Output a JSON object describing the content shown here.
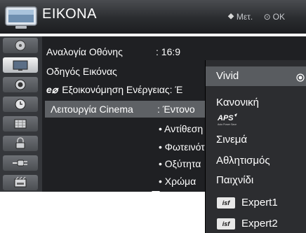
{
  "header": {
    "title": "ΕΙΚΟΝΑ",
    "hint_move": "Μετ.",
    "hint_ok": "OK"
  },
  "sidebar": {
    "items": [
      {
        "icon": "disc-icon",
        "active": false
      },
      {
        "icon": "tv-picture-icon",
        "active": true
      },
      {
        "icon": "speaker-icon",
        "active": false
      },
      {
        "icon": "clock-icon",
        "active": false
      },
      {
        "icon": "settings-grid-icon",
        "active": false
      },
      {
        "icon": "lock-icon",
        "active": false
      },
      {
        "icon": "input-plug-icon",
        "active": false
      },
      {
        "icon": "usb-media-icon",
        "active": false
      }
    ]
  },
  "menu": {
    "rows": [
      {
        "label": "Αναλογία Οθόνης",
        "value": ": 16:9"
      },
      {
        "label": "Οδηγός Εικόνας",
        "value": ""
      },
      {
        "label": "Εξοικονόμηση Ενέργειας: Έ",
        "value": ""
      },
      {
        "label": "Λειτουργία Cinema",
        "value": ": Έντονο"
      }
    ],
    "eco_glyph": "e⌀",
    "subitems": [
      "• Αντίθεση",
      "• Φωτεινότ",
      "• Οξύτητα",
      "• Χρώμα"
    ]
  },
  "dropdown": {
    "selected_index": 0,
    "options": [
      {
        "label": "Vivid"
      },
      {
        "label": "Κανονική"
      },
      {
        "label": "Σινεμά"
      },
      {
        "label": "Αθλητισμός"
      },
      {
        "label": "Παιχνίδι"
      },
      {
        "label": "Expert1",
        "badge": "isf"
      },
      {
        "label": "Expert2",
        "badge": "isf"
      }
    ],
    "aps_label": "APS",
    "aps_sub": "Auto Power Save"
  },
  "colors": {
    "header_bg": "#2a2c2f",
    "panel_bg": "#1f2023",
    "highlight_bg": "#5e6165",
    "dropdown_bg": "#2c2d30"
  }
}
